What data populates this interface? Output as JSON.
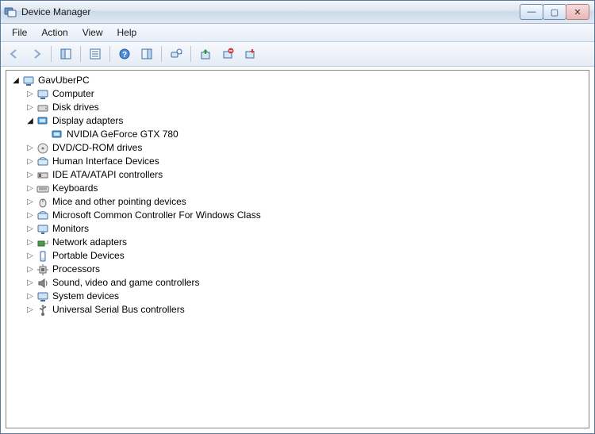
{
  "window": {
    "title": "Device Manager"
  },
  "menu": {
    "file": "File",
    "action": "Action",
    "view": "View",
    "help": "Help"
  },
  "win_controls": {
    "min": "—",
    "max": "▢",
    "close": "✕"
  },
  "tree": {
    "root": {
      "label": "GavUberPC"
    },
    "computer": {
      "label": "Computer"
    },
    "disk_drives": {
      "label": "Disk drives"
    },
    "display_adapters": {
      "label": "Display adapters"
    },
    "gpu": {
      "label": "NVIDIA GeForce GTX 780"
    },
    "dvd": {
      "label": "DVD/CD-ROM drives"
    },
    "hid": {
      "label": "Human Interface Devices"
    },
    "ide": {
      "label": "IDE ATA/ATAPI controllers"
    },
    "keyboards": {
      "label": "Keyboards"
    },
    "mice": {
      "label": "Mice and other pointing devices"
    },
    "ms_controller": {
      "label": "Microsoft Common Controller For Windows Class"
    },
    "monitors": {
      "label": "Monitors"
    },
    "network": {
      "label": "Network adapters"
    },
    "portable": {
      "label": "Portable Devices"
    },
    "processors": {
      "label": "Processors"
    },
    "sound": {
      "label": "Sound, video and game controllers"
    },
    "system": {
      "label": "System devices"
    },
    "usb": {
      "label": "Universal Serial Bus controllers"
    }
  }
}
